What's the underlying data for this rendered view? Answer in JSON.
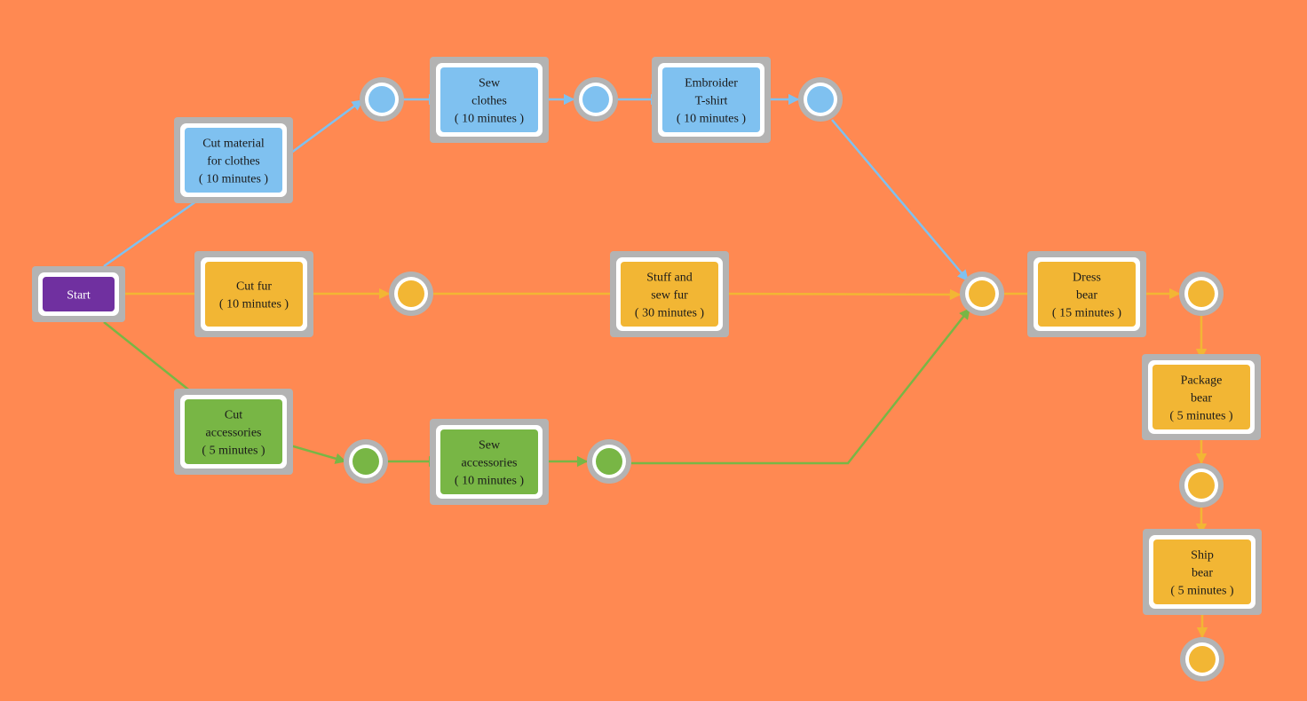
{
  "colors": {
    "background": "#ff8952",
    "frame": "#b3b3b3",
    "border": "#ffffff",
    "clothes": "#7fc1f0",
    "fur": "#f2b634",
    "accessories": "#78b645",
    "start": "#7030a0"
  },
  "tasks": [
    {
      "id": "start",
      "lines": [
        "Start"
      ],
      "color": "start"
    },
    {
      "id": "cut_material",
      "lines": [
        "Cut material",
        "for clothes",
        "( 10 minutes )"
      ],
      "color": "clothes"
    },
    {
      "id": "sew_clothes",
      "lines": [
        "Sew",
        "clothes",
        "( 10 minutes )"
      ],
      "color": "clothes"
    },
    {
      "id": "embroider",
      "lines": [
        "Embroider",
        "T-shirt",
        "( 10 minutes )"
      ],
      "color": "clothes"
    },
    {
      "id": "cut_fur",
      "lines": [
        "Cut fur",
        "( 10 minutes )"
      ],
      "color": "fur"
    },
    {
      "id": "stuff_sew",
      "lines": [
        "Stuff and",
        "sew fur",
        "( 30 minutes )"
      ],
      "color": "fur"
    },
    {
      "id": "dress",
      "lines": [
        "Dress",
        "bear",
        "( 15 minutes )"
      ],
      "color": "fur"
    },
    {
      "id": "package",
      "lines": [
        "Package",
        "bear",
        "( 5 minutes )"
      ],
      "color": "fur"
    },
    {
      "id": "ship",
      "lines": [
        "Ship",
        "bear",
        "( 5 minutes )"
      ],
      "color": "fur"
    },
    {
      "id": "cut_acc",
      "lines": [
        "Cut",
        "accessories",
        "( 5 minutes )"
      ],
      "color": "accessories"
    },
    {
      "id": "sew_acc",
      "lines": [
        "Sew",
        "accessories",
        "( 10 minutes )"
      ],
      "color": "accessories"
    }
  ],
  "events": [
    {
      "id": "e1",
      "color": "clothes"
    },
    {
      "id": "e2",
      "color": "clothes"
    },
    {
      "id": "e3",
      "color": "clothes"
    },
    {
      "id": "e4",
      "color": "fur"
    },
    {
      "id": "e5",
      "color": "fur"
    },
    {
      "id": "e6",
      "color": "fur"
    },
    {
      "id": "e7",
      "color": "fur"
    },
    {
      "id": "e8",
      "color": "fur"
    },
    {
      "id": "g1",
      "color": "accessories"
    },
    {
      "id": "g2",
      "color": "accessories"
    }
  ],
  "edges": [
    {
      "from": "start",
      "to": "cut_material",
      "color": "clothes"
    },
    {
      "from": "cut_material",
      "to": "e1",
      "color": "clothes"
    },
    {
      "from": "e1",
      "to": "sew_clothes",
      "color": "clothes"
    },
    {
      "from": "sew_clothes",
      "to": "e2",
      "color": "clothes"
    },
    {
      "from": "e2",
      "to": "embroider",
      "color": "clothes"
    },
    {
      "from": "embroider",
      "to": "e3",
      "color": "clothes"
    },
    {
      "from": "e3",
      "to": "e5",
      "color": "clothes"
    },
    {
      "from": "start",
      "to": "cut_fur",
      "color": "fur"
    },
    {
      "from": "cut_fur",
      "to": "e4",
      "color": "fur"
    },
    {
      "from": "e4",
      "to": "stuff_sew",
      "color": "fur"
    },
    {
      "from": "stuff_sew",
      "to": "e5",
      "color": "fur"
    },
    {
      "from": "e5",
      "to": "dress",
      "color": "fur"
    },
    {
      "from": "dress",
      "to": "e6",
      "color": "fur"
    },
    {
      "from": "e6",
      "to": "package",
      "color": "fur"
    },
    {
      "from": "package",
      "to": "e7",
      "color": "fur"
    },
    {
      "from": "e7",
      "to": "ship",
      "color": "fur"
    },
    {
      "from": "ship",
      "to": "e8",
      "color": "fur"
    },
    {
      "from": "start",
      "to": "cut_acc",
      "color": "accessories"
    },
    {
      "from": "cut_acc",
      "to": "g1",
      "color": "accessories"
    },
    {
      "from": "g1",
      "to": "sew_acc",
      "color": "accessories"
    },
    {
      "from": "sew_acc",
      "to": "g2",
      "color": "accessories"
    },
    {
      "from": "g2",
      "to": "e5",
      "color": "accessories"
    }
  ]
}
